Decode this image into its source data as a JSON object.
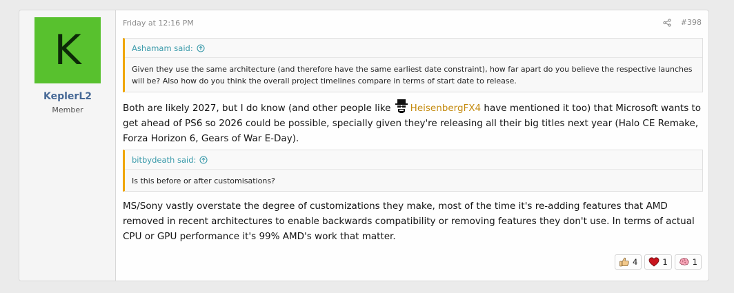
{
  "colors": {
    "avatar_bg": "#58c12e",
    "username": "#476996",
    "quote_author": "#3a9aaa",
    "mention": "#c48a0e",
    "quote_border": "#f0a500"
  },
  "author": {
    "avatar_letter": "K",
    "name": "KeplerL2",
    "title": "Member"
  },
  "post": {
    "date": "Friday at 12:16 PM",
    "number": "#398",
    "share_icon": "share-icon",
    "quotes": [
      {
        "author": "Ashamam said:",
        "text": "Given they use the same architecture (and therefore have the same earliest date constraint), how far apart do you believe the respective launches will be? Also how do you think the overall project timelines compare in terms of start date to release."
      },
      {
        "author": "bitbydeath said:",
        "text": "Is this before or after customisations?"
      }
    ],
    "paragraph1": {
      "before": "Both are likely 2027, but I do know (and other people like ",
      "mention": "HeisenbergFX4",
      "after": " have mentioned it too) that Microsoft wants to get ahead of PS6 so 2026 could be possible, specially given they're releasing all their big titles next year (Halo CE Remake, Forza Horizon 6, Gears of War E-Day)."
    },
    "paragraph2": "MS/Sony vastly overstate the degree of customizations they make, most of the time it's re-adding features that AMD removed in recent architectures to enable backwards compatibility or removing features they don't use. In terms of actual CPU or GPU performance it's 99% AMD's work that matter."
  },
  "reactions": [
    {
      "icon": "thumbs-up-icon",
      "count": "4"
    },
    {
      "icon": "heart-icon",
      "count": "1"
    },
    {
      "icon": "brain-icon",
      "count": "1"
    }
  ]
}
